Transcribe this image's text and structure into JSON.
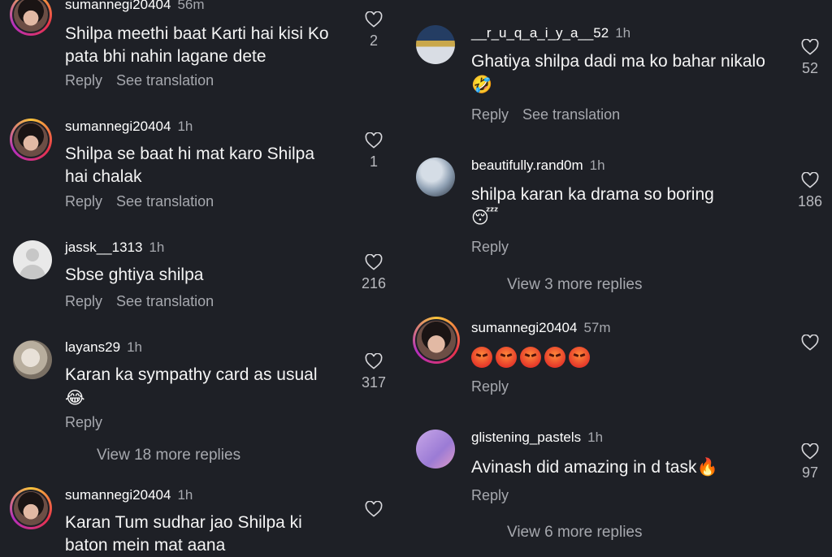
{
  "left_comments": [
    {
      "username": "sumannegi20404",
      "time": "56m",
      "text": "Shilpa meethi baat Karti hai kisi Ko pata bhi nahin lagane dete",
      "reply": "Reply",
      "translate": "See translation",
      "likes": "2"
    },
    {
      "username": "sumannegi20404",
      "time": "1h",
      "text": "Shilpa se baat hi mat karo Shilpa hai chalak",
      "reply": "Reply",
      "translate": "See translation",
      "likes": "1"
    },
    {
      "username": "jassk__1313",
      "time": "1h",
      "text": "Sbse ghtiya shilpa",
      "reply": "Reply",
      "translate": "See translation",
      "likes": "216"
    },
    {
      "username": "layans29",
      "time": "1h",
      "text": "Karan ka sympathy card as usual",
      "emoji": "😂",
      "reply": "Reply",
      "likes": "317",
      "more_replies": "View 18 more replies"
    },
    {
      "username": "sumannegi20404",
      "time": "1h",
      "text": "Karan Tum sudhar jao Shilpa ki baton mein mat aana",
      "likes": ""
    }
  ],
  "right_comments": [
    {
      "username": "__r_u_q_a_i_y_a__52",
      "time": "1h",
      "text": "Ghatiya shilpa dadi ma ko bahar nikalo",
      "emoji": "🤣",
      "reply": "Reply",
      "translate": "See translation",
      "likes": "52"
    },
    {
      "username": "beautifully.rand0m",
      "time": "1h",
      "text": "shilpa karan ka drama so boring",
      "emoji": "😴",
      "reply": "Reply",
      "likes": "186",
      "more_replies": "View 3 more replies"
    },
    {
      "username": "sumannegi20404",
      "time": "57m",
      "text": "",
      "emoji": "😡😡😡😡😡",
      "reply": "Reply",
      "likes": ""
    },
    {
      "username": "glistening_pastels",
      "time": "1h",
      "text": "Avinash did amazing in d task",
      "emoji": "🔥",
      "reply": "Reply",
      "likes": "97",
      "more_replies": "View 6 more replies"
    }
  ],
  "colors": {
    "background": "#1e2026",
    "secondary_text": "#a6a8ae"
  }
}
